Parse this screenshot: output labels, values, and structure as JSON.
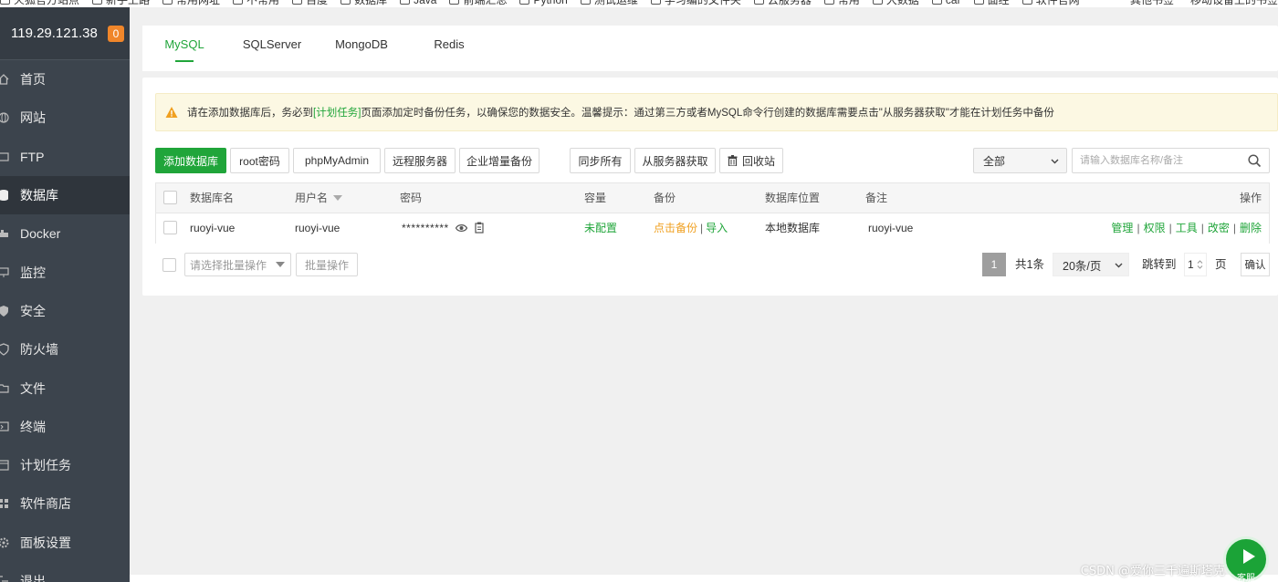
{
  "bookmarks": {
    "items": [
      "火狐官方站点",
      "新手上路",
      "常用网址",
      "不常用",
      "百度",
      "数据库",
      "Java",
      "前端汇总",
      "Python",
      "测试运维",
      "学习编的文件夹",
      "云服务器",
      "常用",
      "大数据",
      "car",
      "面经",
      "软件官网"
    ],
    "right_items": [
      "其他书签",
      "移动设备上的书签"
    ]
  },
  "sidebar": {
    "server_ip": "119.29.121.38",
    "badge": "0",
    "items": [
      {
        "label": "首页",
        "icon": "home-icon"
      },
      {
        "label": "网站",
        "icon": "globe-icon"
      },
      {
        "label": "FTP",
        "icon": "ftp-icon"
      },
      {
        "label": "数据库",
        "icon": "database-icon"
      },
      {
        "label": "Docker",
        "icon": "docker-icon"
      },
      {
        "label": "监控",
        "icon": "monitor-icon"
      },
      {
        "label": "安全",
        "icon": "shield-icon"
      },
      {
        "label": "防火墙",
        "icon": "firewall-icon"
      },
      {
        "label": "文件",
        "icon": "folder-icon"
      },
      {
        "label": "终端",
        "icon": "terminal-icon"
      },
      {
        "label": "计划任务",
        "icon": "schedule-icon"
      },
      {
        "label": "软件商店",
        "icon": "store-icon"
      },
      {
        "label": "面板设置",
        "icon": "gear-icon"
      },
      {
        "label": "退出",
        "icon": "logout-icon"
      }
    ],
    "active_index": 3
  },
  "tabs": [
    "MySQL",
    "SQLServer",
    "MongoDB",
    "Redis"
  ],
  "notice": {
    "prefix": "请在添加数据库后，务必到",
    "link": "[计划任务]",
    "suffix": "页面添加定时备份任务，以确保您的数据安全。温馨提示：通过第三方或者MySQL命令行创建的数据库需要点击\"从服务器获取\"才能在计划任务中备份"
  },
  "toolbar": {
    "add_db": "添加数据库",
    "root_pwd": "root密码",
    "phpmyadmin": "phpMyAdmin",
    "remote_server": "远程服务器",
    "enterprise_backup": "企业增量备份",
    "sync_all": "同步所有",
    "fetch_from_server": "从服务器获取",
    "recycle_bin": "回收站",
    "filter_value": "全部",
    "search_placeholder": "请输入数据库名称/备注"
  },
  "table": {
    "headers": {
      "name": "数据库名",
      "user": "用户名",
      "password": "密码",
      "capacity": "容量",
      "backup": "备份",
      "location": "数据库位置",
      "remark": "备注",
      "actions": "操作"
    },
    "rows": [
      {
        "name": "ruoyi-vue",
        "user": "ruoyi-vue",
        "password": "**********",
        "capacity": "未配置",
        "backup_click": "点击备份",
        "backup_import": "导入",
        "location": "本地数据库",
        "remark": "ruoyi-vue",
        "actions": [
          "管理",
          "权限",
          "工具",
          "改密",
          "删除"
        ]
      }
    ]
  },
  "footer": {
    "bulk_placeholder": "请选择批量操作",
    "bulk_button": "批量操作",
    "current_page": "1",
    "total": "共1条",
    "page_size": "20条/页",
    "jump_label": "跳转到",
    "jump_value": "1",
    "jump_unit": "页",
    "confirm": "确认"
  },
  "watermark": "CSDN @爱你三千遍斯塔克",
  "float_service_label": "客服",
  "colors": {
    "accent": "#20a53a",
    "sidebar_bg": "#3c444d",
    "warning_bg": "#fcf8e3",
    "badge": "#f0862a",
    "backup_link": "#f0a020"
  }
}
